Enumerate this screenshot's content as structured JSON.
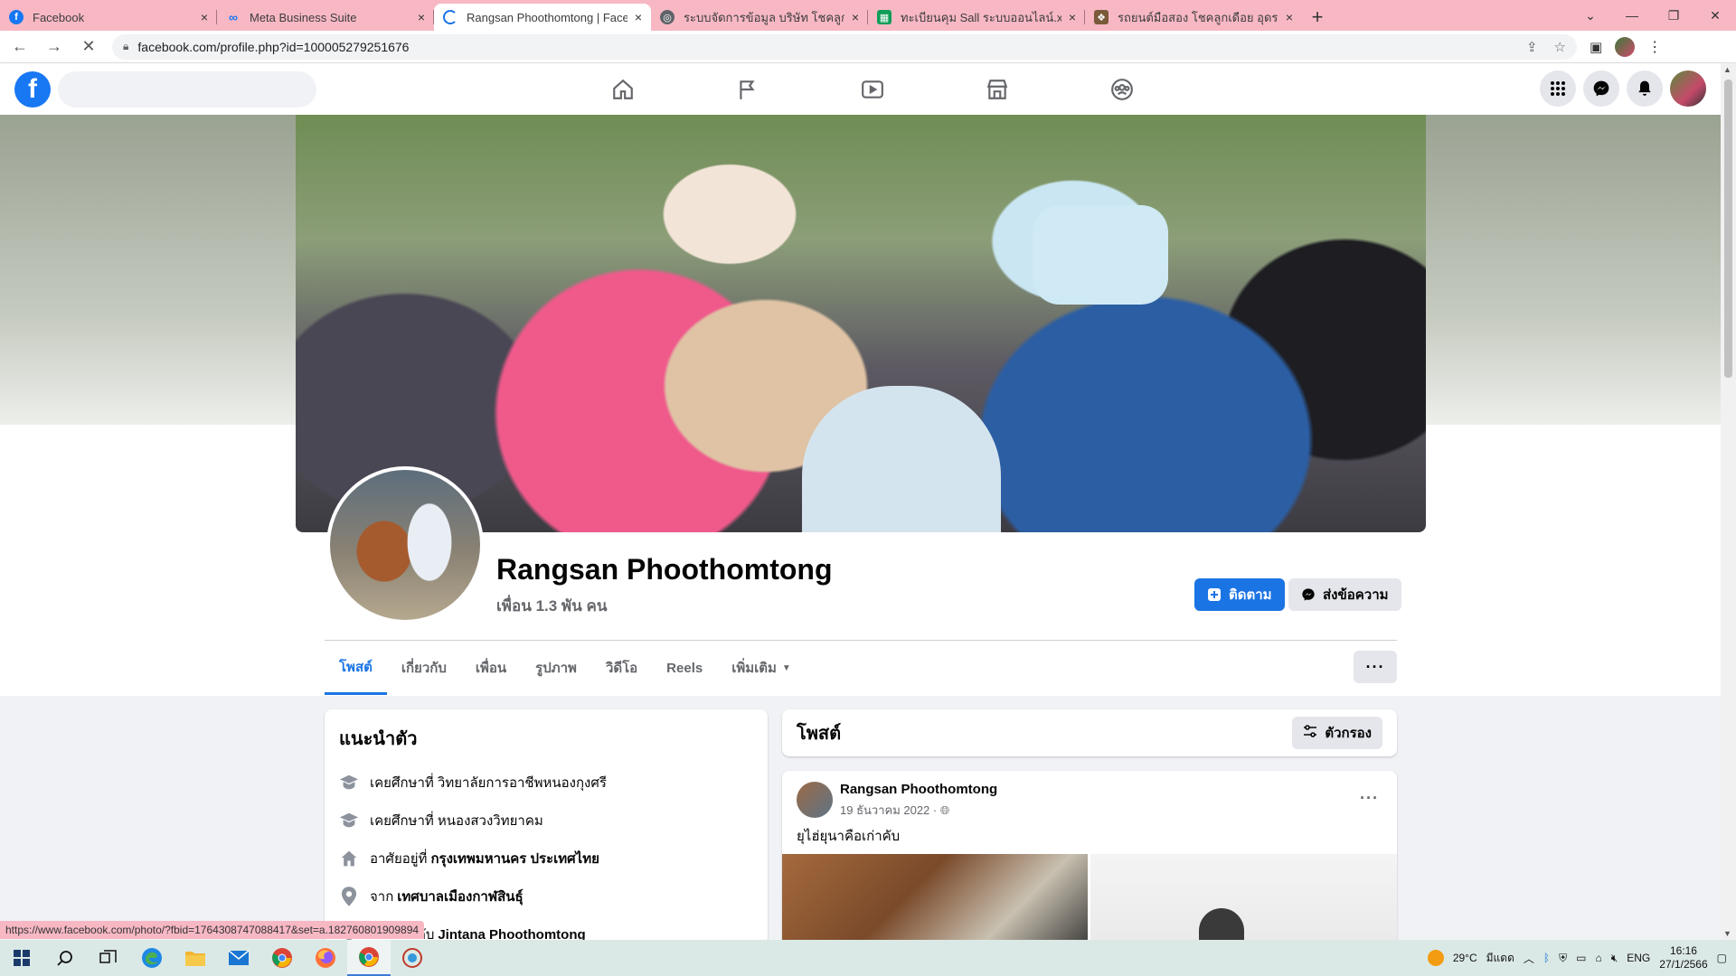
{
  "browser": {
    "tabs": [
      {
        "title": "Facebook",
        "close": "×"
      },
      {
        "title": "Meta Business Suite",
        "close": "×"
      },
      {
        "title": "Rangsan Phoothomtong | Facebook",
        "close": "×"
      },
      {
        "title": "ระบบจัดการข้อมูล บริษัท โชคลูกเดือย",
        "close": "×"
      },
      {
        "title": "ทะเบียนคุม Sall ระบบออนไลน์.xlsx - G",
        "close": "×"
      },
      {
        "title": "รถยนต์มือสอง โชคลูกเดือย อุดรธานี",
        "close": "×"
      }
    ],
    "new_tab": "+",
    "url": "facebook.com/profile.php?id=100005279251676",
    "status_link": "https://www.facebook.com/photo/?fbid=1764308747088417&set=a.182760801909894"
  },
  "profile": {
    "name": "Rangsan Phoothomtong",
    "friends": "เพื่อน 1.3 พัน คน",
    "follow_label": "ติดตาม",
    "message_label": "ส่งข้อความ",
    "tabs": [
      "โพสต์",
      "เกี่ยวกับ",
      "เพื่อน",
      "รูปภาพ",
      "วิดีโอ",
      "Reels",
      "เพิ่มเติม"
    ],
    "more": "···"
  },
  "intro": {
    "title": "แนะนำตัว",
    "items": [
      {
        "icon": "graduation-cap-icon",
        "prefix": "เคยศึกษาที่ วิทยาลัยการอาชีพหนองกุงศรี",
        "bold": ""
      },
      {
        "icon": "graduation-cap-icon",
        "prefix": "เคยศึกษาที่ หนองสวงวิทยาคม",
        "bold": ""
      },
      {
        "icon": "home-icon",
        "prefix": "อาศัยอยู่ที่",
        "bold": "กรุงเทพมหานคร ประเทศไทย"
      },
      {
        "icon": "location-pin-icon",
        "prefix": "จาก",
        "bold": "เทศบาลเมืองกาฬสินธุ์"
      },
      {
        "icon": "heart-icon",
        "prefix": "แต่งงานกับ",
        "bold": "Jintana Phoothomtong"
      }
    ]
  },
  "posts": {
    "title": "โพสต์",
    "filter_label": "ตัวกรอง",
    "first_post": {
      "author": "Rangsan Phoothomtong",
      "date": "19 ธันวาคม 2022 ·",
      "text": "ยุไฮ่ยุนาคือเก่าคับ",
      "menu": "···"
    }
  },
  "taskbar": {
    "weather": "29°C",
    "weather_desc": "มีแดด",
    "lang": "ENG",
    "time": "16:16",
    "date": "27/1/2566"
  },
  "colors": {
    "fb_blue": "#1b74e4",
    "tab_bar": "#f7b8c4",
    "taskbar": "#dbe9e6"
  }
}
